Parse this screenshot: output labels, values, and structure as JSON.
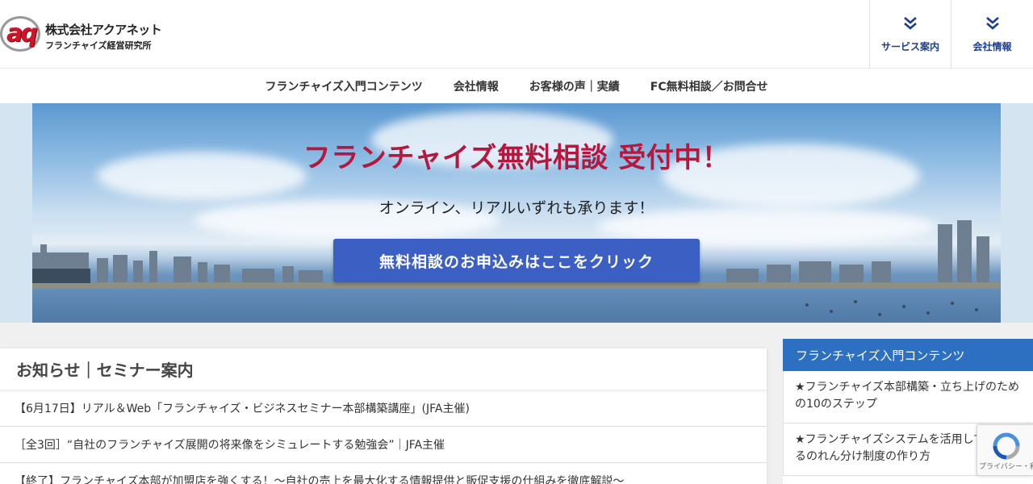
{
  "header": {
    "logo": {
      "mark": "aq",
      "name": "株式会社アクアネット",
      "sub": "フランチャイズ経営研究所"
    },
    "buttons": [
      {
        "label": "サービス案内"
      },
      {
        "label": "会社情報"
      }
    ]
  },
  "nav": {
    "items": [
      {
        "label": "フランチャイズ入門コンテンツ"
      },
      {
        "label": "会社情報"
      },
      {
        "label": "お客様の声｜実績"
      },
      {
        "label": "FC無料相談／お問合せ"
      }
    ]
  },
  "hero": {
    "title": "フランチャイズ無料相談 受付中！",
    "subtitle": "オンライン、リアルいずれも承ります！",
    "cta": "無料相談のお申込みはここをクリック"
  },
  "news": {
    "title": "お知らせ｜セミナー案内",
    "items": [
      {
        "text": "【6月17日】リアル＆Web「フランチャイズ・ビジネスセミナー本部構築講座」(JFA主催)"
      },
      {
        "text": "［全3回］“自社のフランチャイズ展開の将来像をシミュレートする勉強会”｜JFA主催"
      },
      {
        "text": "【終了】フランチャイズ本部が加盟店を強くする！～自社の売上を最大化する情報提供と販促支援の仕組みを徹底解説～"
      }
    ]
  },
  "sidebar": {
    "title": "フランチャイズ入門コンテンツ",
    "items": [
      {
        "text": "★フランチャイズ本部構築・立ち上げのための10のステップ"
      },
      {
        "text": "★フランチャイズシステムを活用して成功するのれん分け制度の作り方"
      }
    ]
  },
  "recaptcha": {
    "text": "プライバシー・利用規約"
  },
  "colors": {
    "accent": "#1c3d8e",
    "hero_title": "#b3183f",
    "cta": "#3b5fc2",
    "sidebar_head": "#2d6fc0"
  }
}
